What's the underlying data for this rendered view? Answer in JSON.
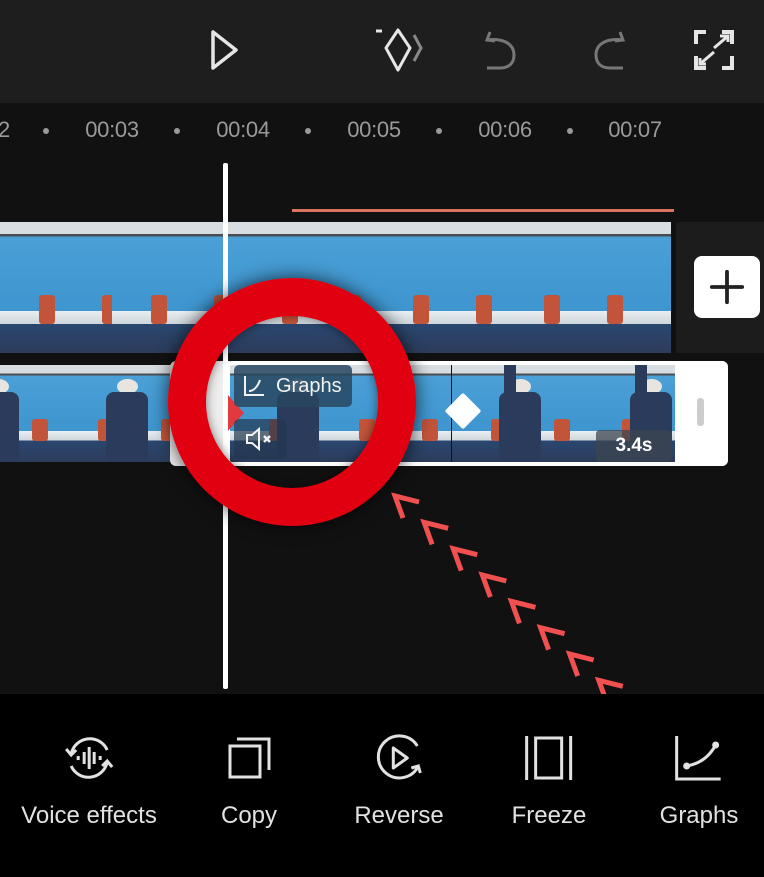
{
  "toolbar": {
    "icons": [
      "play-icon",
      "keyframe-icon",
      "undo-icon",
      "redo-icon",
      "fullscreen-icon"
    ]
  },
  "timeline": {
    "ticks": [
      "2",
      "00:03",
      "00:04",
      "00:05",
      "00:06",
      "00:07"
    ],
    "playhead_time": "00:04"
  },
  "main_track": {
    "add_label": "+"
  },
  "selected_clip": {
    "effect_tag": "Graphs",
    "duration": "3.4s",
    "muted": true
  },
  "annotation": {
    "highlight": "red-circle",
    "arrow_color": "#f05050",
    "ring_color": "#e0000f"
  },
  "colors": {
    "accent_line": "#d9735f",
    "background": "#111111",
    "toolbar": "#1e1e1e"
  },
  "bottom_tools": [
    {
      "label": "Voice effects",
      "icon": "voice-effects-icon"
    },
    {
      "label": "Copy",
      "icon": "copy-icon"
    },
    {
      "label": "Reverse",
      "icon": "reverse-icon"
    },
    {
      "label": "Freeze",
      "icon": "freeze-icon"
    },
    {
      "label": "Graphs",
      "icon": "graphs-icon"
    }
  ]
}
